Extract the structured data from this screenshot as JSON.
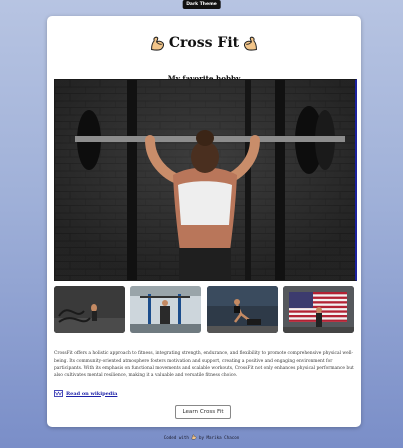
{
  "theme_toggle": {
    "label": "Dark Theme"
  },
  "card": {
    "title": "Cross Fit",
    "subtitle": "My favorite hobby",
    "description": "CrossFit offers a holistic approach to fitness, integrating strength, endurance, and flexibility to promote comprehensive physical well-being. Its community-oriented atmosphere fosters motivation and support, creating a positive and engaging environment for participants. With its emphasis on functional movements and scalable workouts, CrossFit not only enhances physical performance but also cultivates mental resilience, making it a valuable and versatile fitness choice.",
    "wiki_link": "Read on wikipedia",
    "learn_button": "Learn Cross Fit"
  },
  "icons": {
    "flex_left": "flexed-biceps-icon",
    "flex_right": "flexed-biceps-icon",
    "wiki": "wikipedia-icon",
    "footer": "flexed-biceps-icon"
  },
  "footer": {
    "prefix": "Coded with",
    "suffix": "by Marika Chacon"
  }
}
